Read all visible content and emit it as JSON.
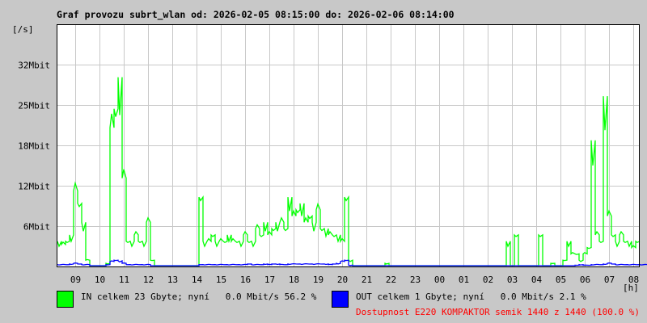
{
  "chart_data": {
    "type": "line",
    "title": "Graf provozu subrt_wlan od: 2026-02-05 08:15:00 do: 2026-02-06 08:14:00",
    "ylabel": "[/s]",
    "xlabel": "[h]",
    "ylim": [
      0,
      38.4
    ],
    "y_ticks": [
      {
        "value": 6.4,
        "label": "6Mbit"
      },
      {
        "value": 12.8,
        "label": "12Mbit"
      },
      {
        "value": 19.2,
        "label": "18Mbit"
      },
      {
        "value": 25.6,
        "label": "25Mbit"
      },
      {
        "value": 32,
        "label": "32Mbit"
      }
    ],
    "x_start_hour": 8.25,
    "x_span_hours": 24,
    "bin_minutes": 10,
    "x_ticks": [
      "09",
      "10",
      "11",
      "12",
      "13",
      "14",
      "15",
      "16",
      "17",
      "18",
      "19",
      "20",
      "21",
      "22",
      "23",
      "00",
      "01",
      "02",
      "03",
      "04",
      "05",
      "06",
      "07",
      "08"
    ],
    "grid": true,
    "series": [
      {
        "name": "IN",
        "color": "#00ff00",
        "unit": "Mbit/s",
        "values": [
          4,
          3.5,
          4,
          5,
          12,
          10,
          7,
          1,
          0,
          0,
          0,
          0,
          0.5,
          22,
          25,
          30,
          14,
          4,
          4,
          5,
          4,
          4,
          7,
          1,
          0,
          0,
          0,
          0,
          0,
          0,
          0,
          0,
          0,
          0,
          0,
          11,
          4,
          4,
          5,
          4,
          4,
          4,
          5,
          4,
          4,
          4,
          5,
          4,
          4,
          6,
          5,
          7,
          5,
          6,
          7,
          7,
          6,
          11,
          8,
          9,
          10,
          7,
          8,
          7,
          9,
          6,
          6,
          5,
          5,
          5,
          4,
          11,
          1,
          0,
          0,
          0,
          0,
          0,
          0,
          0,
          0,
          0.5,
          0,
          0,
          0,
          0,
          0,
          0,
          0,
          0,
          0,
          0,
          0,
          0,
          0,
          0,
          0,
          0,
          0,
          0,
          0,
          0,
          0,
          0,
          0,
          0,
          0,
          0,
          0,
          0,
          0,
          4,
          0,
          5,
          0,
          0,
          0,
          0,
          0,
          5,
          0,
          0,
          0.5,
          0,
          0,
          1,
          4,
          2,
          2,
          1,
          2,
          3,
          20,
          5,
          4,
          27,
          8,
          5,
          4,
          5,
          4,
          4,
          3,
          4
        ]
      },
      {
        "name": "OUT",
        "color": "#0000ff",
        "unit": "Mbit/s",
        "values": [
          0.3,
          0.3,
          0.3,
          0.4,
          0.5,
          0.4,
          0.3,
          0.3,
          0,
          0,
          0,
          0,
          0.3,
          0.8,
          1,
          0.9,
          0.5,
          0.3,
          0.3,
          0.3,
          0.3,
          0.3,
          0.3,
          0,
          0,
          0,
          0,
          0,
          0,
          0,
          0,
          0,
          0,
          0,
          0,
          0.3,
          0.3,
          0.3,
          0.3,
          0.3,
          0.3,
          0.3,
          0.3,
          0.3,
          0.3,
          0.3,
          0.3,
          0.4,
          0.3,
          0.3,
          0.3,
          0.4,
          0.3,
          0.4,
          0.4,
          0.3,
          0.3,
          0.4,
          0.4,
          0.4,
          0.4,
          0.4,
          0.4,
          0.4,
          0.4,
          0.4,
          0.4,
          0.3,
          0.4,
          0.5,
          0.8,
          1,
          0.2,
          0,
          0,
          0,
          0,
          0,
          0,
          0,
          0,
          0,
          0,
          0,
          0,
          0,
          0,
          0,
          0,
          0,
          0,
          0,
          0,
          0,
          0,
          0,
          0,
          0,
          0,
          0,
          0,
          0,
          0,
          0,
          0,
          0,
          0,
          0,
          0,
          0,
          0,
          0,
          0,
          0,
          0,
          0,
          0,
          0,
          0,
          0,
          0,
          0,
          0,
          0,
          0,
          0,
          0,
          0,
          0.2,
          0.3,
          0.2,
          0.2,
          0.3,
          0.3,
          0.3,
          0.4,
          0.5,
          0.4,
          0.3,
          0.3,
          0.3,
          0.3,
          0.3,
          0.3,
          0.3,
          0.3
        ]
      }
    ],
    "legend": [
      {
        "color": "#00ff00",
        "text": "IN celkem 23 Gbyte; nyní   0.0 Mbit/s 56.2 %"
      },
      {
        "color": "#0000ff",
        "text": "OUT celkem 1 Gbyte; nyní   0.0 Mbit/s 2.1 %"
      }
    ],
    "annotation": {
      "text": "Dostupnost E220 KOMPAKTOR semik 1440 z 1440 (100.0 %)",
      "color": "#ff0000"
    }
  }
}
